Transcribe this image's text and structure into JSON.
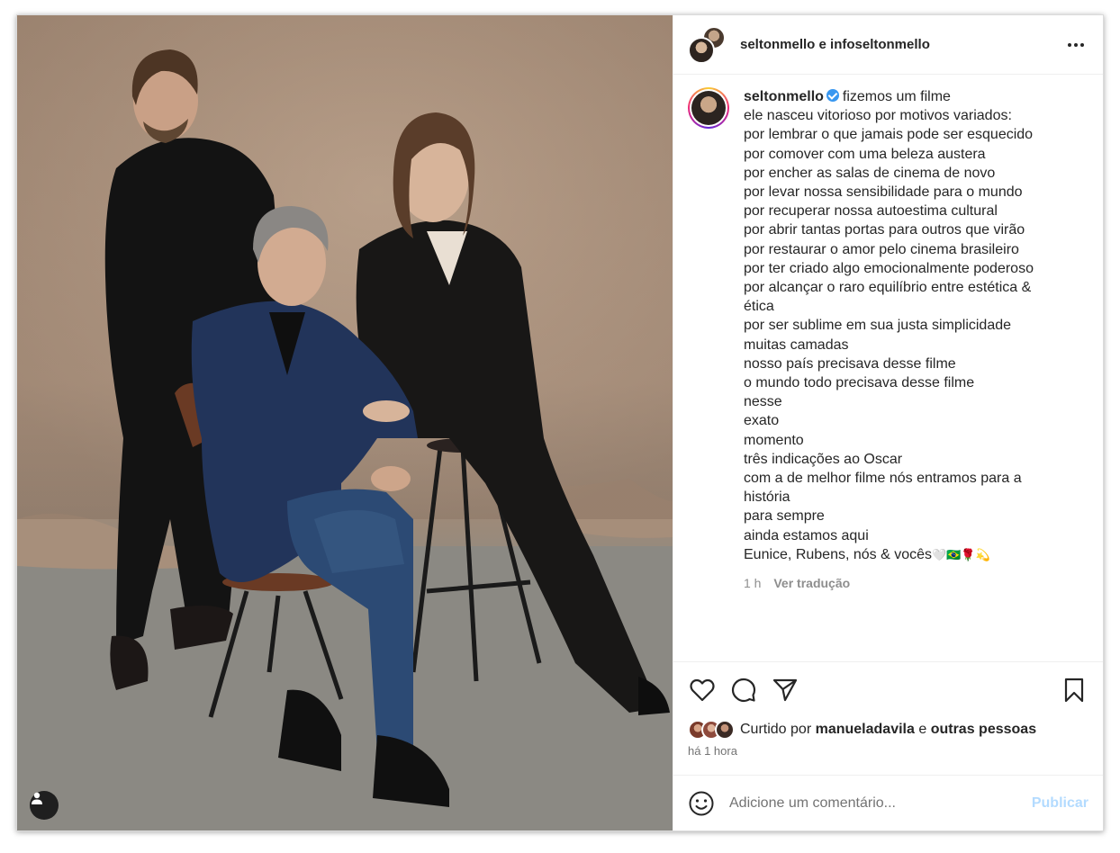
{
  "header": {
    "title": "seltonmello e infoseltonmello",
    "more_icon": "more-horizontal-icon"
  },
  "caption": {
    "username": "seltonmello",
    "first_line": "fizemos um filme",
    "lines": [
      "ele nasceu vitorioso por motivos variados:",
      "por lembrar o que jamais pode ser esquecido",
      "por comover com uma beleza austera",
      "por encher as salas de cinema de novo",
      "por levar nossa sensibilidade para o mundo",
      "por recuperar nossa autoestima cultural",
      "por abrir tantas portas para outros que virão",
      "por restaurar o amor pelo cinema brasileiro",
      "por ter criado algo emocionalmente poderoso",
      "por alcançar o raro equilíbrio entre estética &",
      "ética",
      "por ser sublime em sua justa simplicidade",
      "muitas camadas",
      "nosso país precisava desse filme",
      "o mundo todo precisava desse filme",
      "nesse",
      "exato",
      "momento",
      "três indicações ao Oscar",
      "com a de melhor filme nós entramos para a",
      "história",
      "para sempre",
      "ainda estamos aqui"
    ],
    "last_line": "Eunice, Rubens, nós & vocês",
    "last_line_emoji": "🤍🇧🇷🌹💫",
    "age": "1 h",
    "translate_label": "Ver tradução"
  },
  "likes": {
    "prefix": "Curtido por",
    "user": "manueladavila",
    "connector": "e",
    "others": "outras pessoas"
  },
  "timestamp": "há 1 hora",
  "comment": {
    "placeholder": "Adicione um comentário...",
    "post_label": "Publicar"
  },
  "colors": {
    "verified": "#3897f0",
    "post_disabled": "#b3dbff",
    "backdrop": "#a88f7a"
  }
}
